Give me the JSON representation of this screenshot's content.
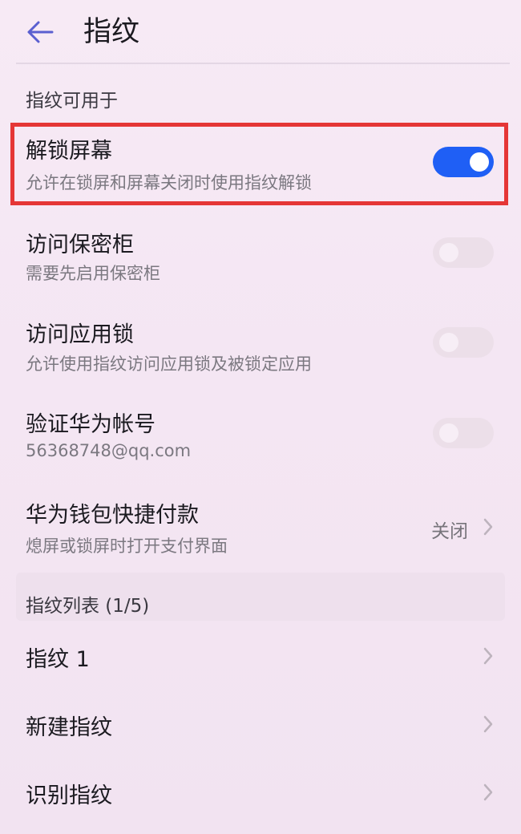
{
  "header": {
    "title": "指纹"
  },
  "sections": {
    "usage_title": "指纹可用于",
    "list_title": "指纹列表 (1/5)"
  },
  "settings": [
    {
      "title": "解锁屏幕",
      "subtitle": "允许在锁屏和屏幕关闭时使用指纹解锁",
      "toggle": true
    },
    {
      "title": "访问保密柜",
      "subtitle": "需要先启用保密柜",
      "toggle": false
    },
    {
      "title": "访问应用锁",
      "subtitle": "允许使用指纹访问应用锁及被锁定应用",
      "toggle": false
    },
    {
      "title": "验证华为帐号",
      "subtitle": "56368748@qq.com",
      "toggle": false
    },
    {
      "title": "华为钱包快捷付款",
      "subtitle": "熄屏或锁屏时打开支付界面",
      "value": "关闭"
    }
  ],
  "fingerprint_list": [
    {
      "label": "指纹 1"
    },
    {
      "label": "新建指纹"
    },
    {
      "label": "识别指纹"
    }
  ],
  "colors": {
    "accent": "#1f5ff5",
    "highlight_border": "#e53636",
    "back_arrow": "#5a5fd0"
  }
}
